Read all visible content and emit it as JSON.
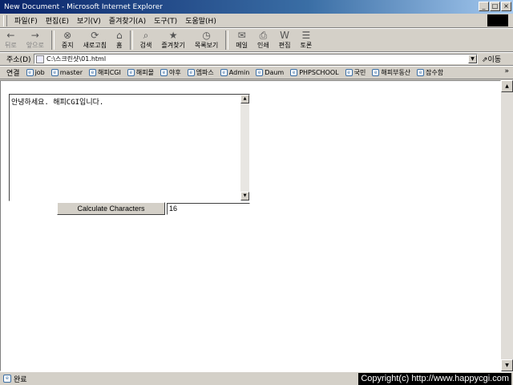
{
  "window": {
    "title": "New Document - Microsoft Internet Explorer",
    "buttons": [
      "_",
      "□",
      "×"
    ]
  },
  "menubar": {
    "items": [
      "파일(F)",
      "편집(E)",
      "보기(V)",
      "즐겨찾기(A)",
      "도구(T)",
      "도움말(H)"
    ]
  },
  "toolbar": {
    "buttons": [
      {
        "label": "뒤로",
        "icon": "back-arrow-icon",
        "glyph": "←",
        "disabled": true
      },
      {
        "label": "앞으로",
        "icon": "forward-arrow-icon",
        "glyph": "→",
        "disabled": true
      },
      {
        "label": "중지",
        "icon": "stop-icon",
        "glyph": "⊗",
        "disabled": false
      },
      {
        "label": "새로고침",
        "icon": "refresh-icon",
        "glyph": "⟳",
        "disabled": false
      },
      {
        "label": "홈",
        "icon": "home-icon",
        "glyph": "⌂",
        "disabled": false
      },
      {
        "label": "검색",
        "icon": "search-icon",
        "glyph": "⌕",
        "disabled": false
      },
      {
        "label": "즐겨찾기",
        "icon": "favorites-icon",
        "glyph": "★",
        "disabled": false
      },
      {
        "label": "목록보기",
        "icon": "history-icon",
        "glyph": "◷",
        "disabled": false
      },
      {
        "label": "메일",
        "icon": "mail-icon",
        "glyph": "✉",
        "disabled": false
      },
      {
        "label": "인쇄",
        "icon": "print-icon",
        "glyph": "⎙",
        "disabled": false
      },
      {
        "label": "편집",
        "icon": "edit-icon",
        "glyph": "W",
        "disabled": false
      },
      {
        "label": "토론",
        "icon": "discuss-icon",
        "glyph": "☰",
        "disabled": false
      }
    ]
  },
  "address": {
    "label": "주소(D)",
    "value": "C:\\스크린샷\\01.html",
    "go_label": "⇗이동"
  },
  "links": {
    "label": "연결",
    "items": [
      "job",
      "master",
      "해피CGI",
      "해피몰",
      "야후",
      "엠파스",
      "Admin",
      "Daum",
      "PHPSCHOOL",
      "국민",
      "해피부동산",
      "잡수함"
    ],
    "more": "»"
  },
  "page": {
    "textarea_value": "안녕하세요. 해피CGI입니다.",
    "calc_button_label": "Calculate Characters",
    "count_value": "16"
  },
  "status": {
    "text": "완료",
    "copyright": "Copyright(c) http://www.happycgi.com"
  }
}
